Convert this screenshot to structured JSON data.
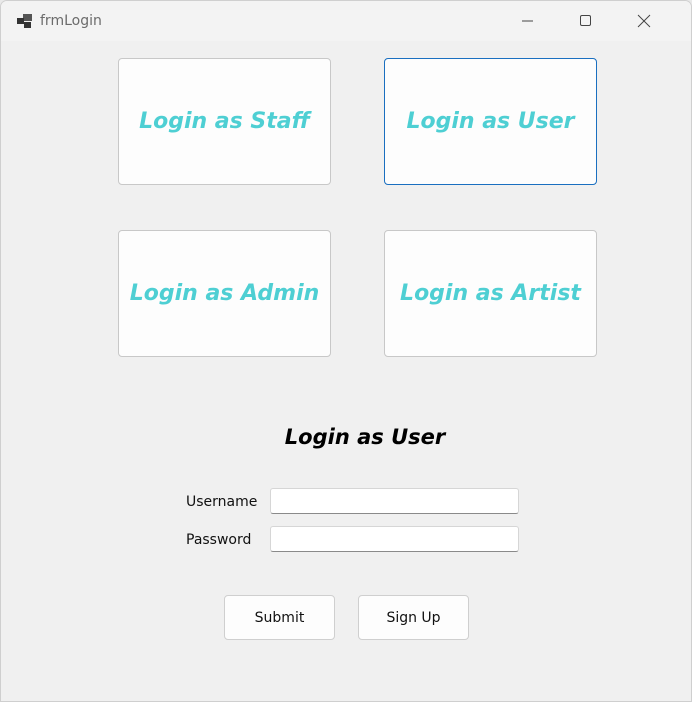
{
  "window": {
    "title": "frmLogin",
    "icon": "app-icon"
  },
  "roles": {
    "staff": "Login as Staff",
    "user": "Login as User",
    "admin": "Login as Admin",
    "artist": "Login as Artist",
    "selected": "user"
  },
  "form": {
    "heading": "Login as User",
    "username_label": "Username",
    "username_value": "",
    "password_label": "Password",
    "password_value": ""
  },
  "actions": {
    "submit": "Submit",
    "signup": "Sign Up"
  },
  "colors": {
    "role_text": "#4ecfd3",
    "focus_border": "#1a6fc0",
    "background": "#f0f0f0"
  }
}
